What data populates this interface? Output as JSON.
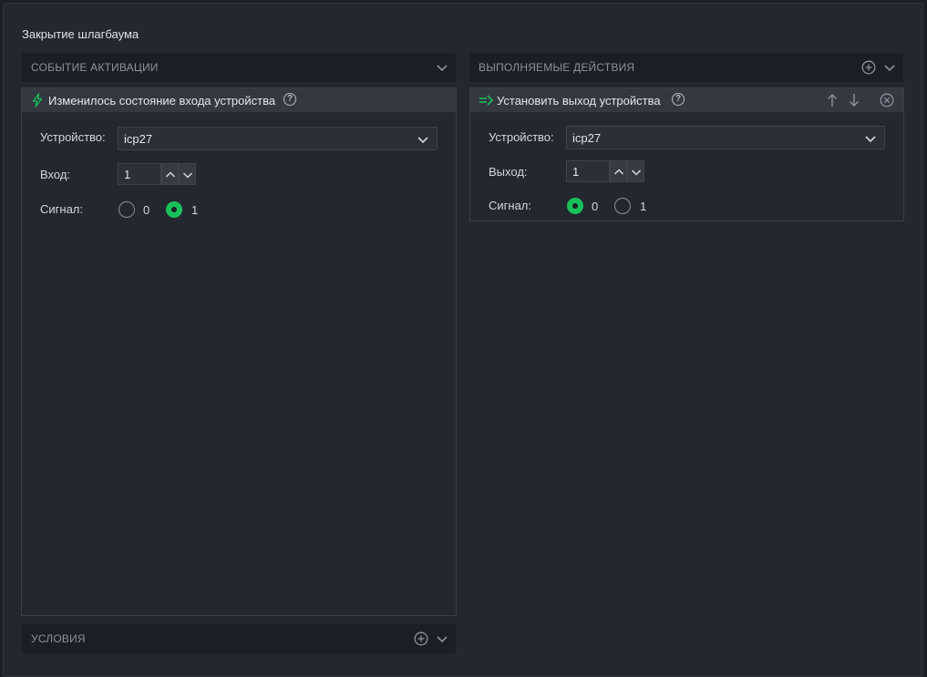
{
  "rule": {
    "title": "Закрытие шлагбаума"
  },
  "activation": {
    "header": "СОБЫТИЕ АКТИВАЦИИ",
    "card": {
      "title": "Изменилось состояние входа устройства",
      "help_symbol": "?",
      "device_label": "Устройство:",
      "device_value": "icp27",
      "input_label": "Вход:",
      "input_value": "1",
      "signal_label": "Сигнал:",
      "signal_options": [
        "0",
        "1"
      ],
      "signal_selected": "1"
    }
  },
  "conditions": {
    "header": "УСЛОВИЯ"
  },
  "actions": {
    "header": "ВЫПОЛНЯЕМЫЕ ДЕЙСТВИЯ",
    "card": {
      "title": "Установить выход устройства",
      "help_symbol": "?",
      "device_label": "Устройство:",
      "device_value": "icp27",
      "output_label": "Выход:",
      "output_value": "1",
      "signal_label": "Сигнал:",
      "signal_options": [
        "0",
        "1"
      ],
      "signal_selected": "0"
    }
  },
  "icons": {
    "trigger": "lightning-icon",
    "action": "arrow-right-lines-icon",
    "expand": "chevron-down-icon",
    "add": "plus-circle-icon",
    "move_up": "arrow-up-icon",
    "move_down": "arrow-down-icon",
    "remove": "close-circle-icon"
  },
  "colors": {
    "accent": "#19c15b",
    "background": "#23272f",
    "header_bg": "#1b1e24",
    "card_header_bg": "#343841"
  }
}
